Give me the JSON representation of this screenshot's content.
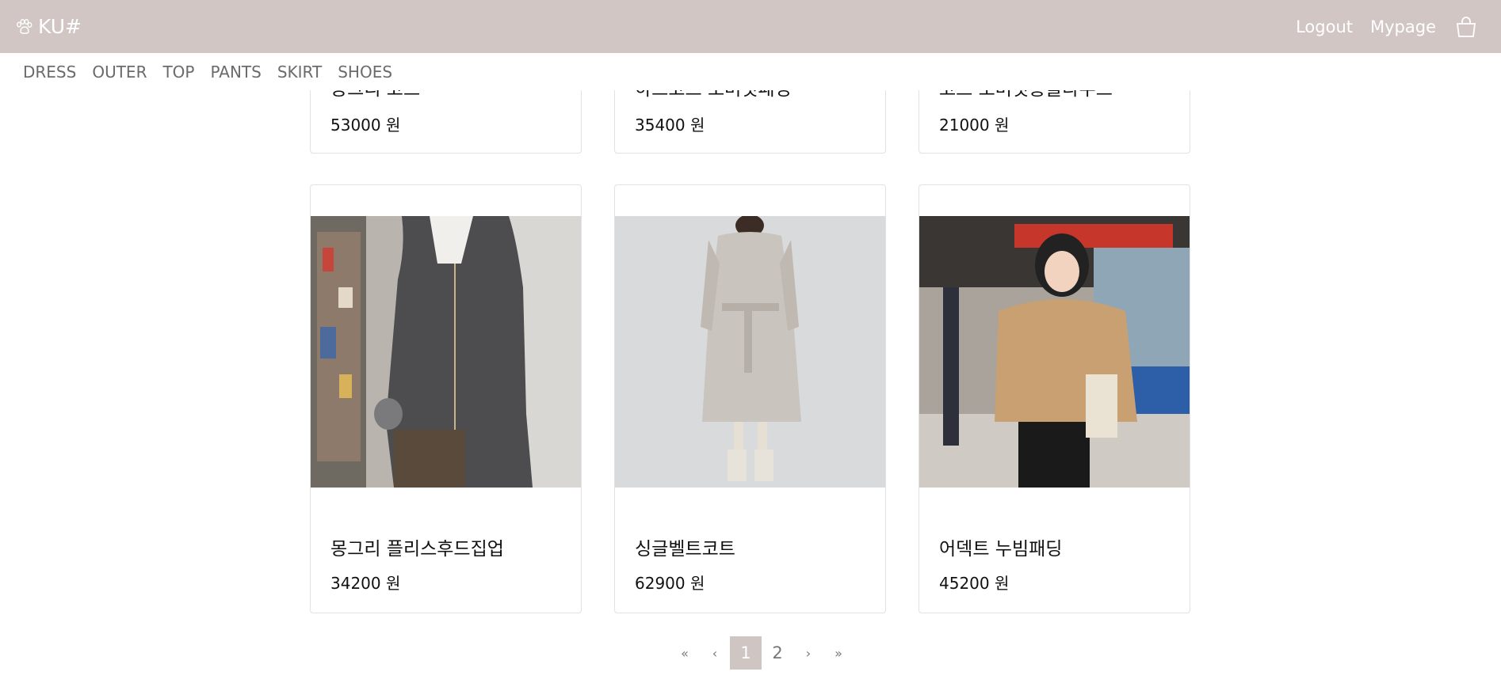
{
  "header": {
    "brand": "KU#",
    "logout": "Logout",
    "mypage": "Mypage"
  },
  "categories": [
    "DRESS",
    "OUTER",
    "TOP",
    "PANTS",
    "SKIRT",
    "SHOES"
  ],
  "products_top": [
    {
      "name": "몽그리 코트",
      "price": "53000 원"
    },
    {
      "name": "하프코트 오버핏패딩",
      "price": "35400 원"
    },
    {
      "name": "코트 오버핏롱블라우스",
      "price": "21000 원"
    }
  ],
  "products_bottom": [
    {
      "name": "몽그리 플리스후드집업",
      "price": "34200 원"
    },
    {
      "name": "싱글벨트코트",
      "price": "62900 원"
    },
    {
      "name": "어덱트 누빔패딩",
      "price": "45200 원"
    }
  ],
  "pagination": {
    "first": "«",
    "prev": "‹",
    "pages": [
      "1",
      "2"
    ],
    "current": "1",
    "next": "›",
    "last": "»"
  },
  "colors": {
    "header_bg": "#d1c6c4",
    "active_page_bg": "#cfc6c3"
  },
  "icons": [
    "paw-icon",
    "shopping-bag-icon"
  ]
}
